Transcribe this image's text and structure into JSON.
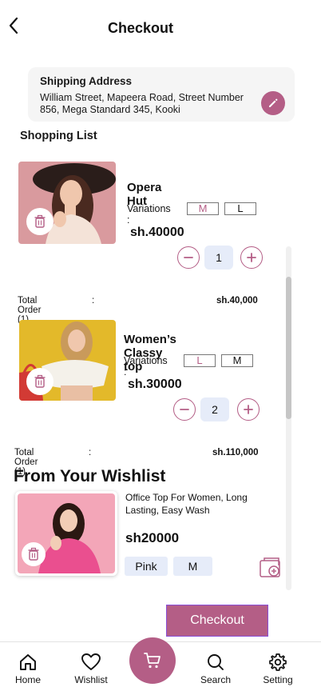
{
  "header": {
    "title": "Checkout"
  },
  "shipping": {
    "title": "Shipping Address",
    "address": "William Street, Mapeera Road, Street Number 856, Mega Standard 345, Kooki"
  },
  "shopping_list": {
    "title": "Shopping List",
    "items": [
      {
        "name": "Opera Hut",
        "variations_label": "Variations :",
        "variations": [
          "M",
          "L"
        ],
        "price": "sh.40000",
        "quantity": "1",
        "total_label": "Total Order (1)",
        "total_colon": ":",
        "total_value": "sh.40,000"
      },
      {
        "name": "Women’s Classy top",
        "variations_label": "Variations :",
        "variations": [
          "L",
          "M"
        ],
        "price": "sh.30000",
        "quantity": "2",
        "total_label": "Total Order (1)",
        "total_colon": ":",
        "total_value": "sh.110,000"
      }
    ]
  },
  "wishlist": {
    "title": "From Your Wishlist",
    "item": {
      "description": "Office Top For Women, Long Lasting, Easy Wash",
      "price": "sh20000",
      "color": "Pink",
      "size": "M"
    }
  },
  "checkout_label": "Checkout",
  "nav": {
    "home": "Home",
    "wishlist": "Wishlist",
    "search": "Search",
    "setting": "Setting"
  },
  "colors": {
    "accent": "#b45e86",
    "chip_bg": "#e6ecf9",
    "card_bg": "#f5f5f5"
  }
}
